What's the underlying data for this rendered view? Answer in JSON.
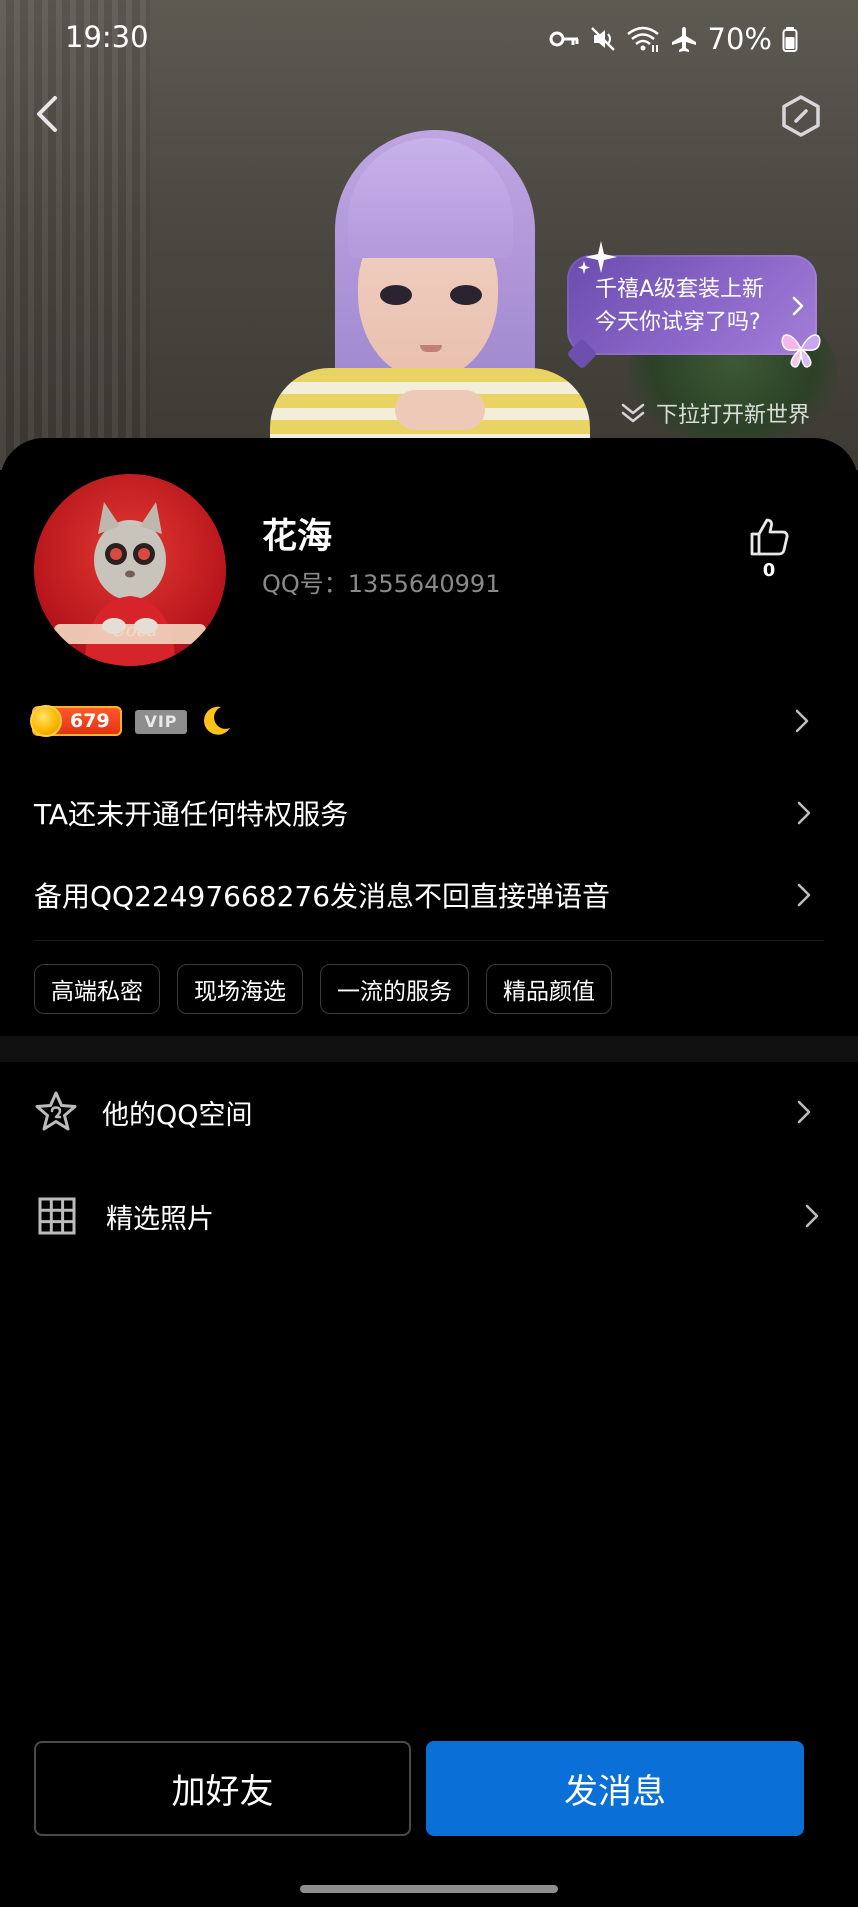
{
  "status_bar": {
    "time": "19:30",
    "battery": "70%"
  },
  "hero": {
    "bubble": {
      "line1": "千禧A级套装上新",
      "line2": "今天你试穿了吗?"
    },
    "pull_hint": "下拉打开新世界"
  },
  "profile": {
    "nickname": "花海",
    "qq_number": "QQ号：1355640991",
    "likes": "0",
    "level": "679",
    "vip_label": "VIP"
  },
  "rows": {
    "privilege": "TA还未开通任何特权服务",
    "signature": "备用QQ22497668276发消息不回直接弹语音"
  },
  "tags": [
    "高端私密",
    "现场海选",
    "一流的服务",
    "精品颜值"
  ],
  "menu": {
    "qzone": "他的QQ空间",
    "photos": "精选照片"
  },
  "actions": {
    "add_friend": "加好友",
    "send_message": "发消息"
  },
  "colors": {
    "primary_button": "#0a6fd6",
    "background": "#000000",
    "secondary_text": "#8a8a8a"
  }
}
